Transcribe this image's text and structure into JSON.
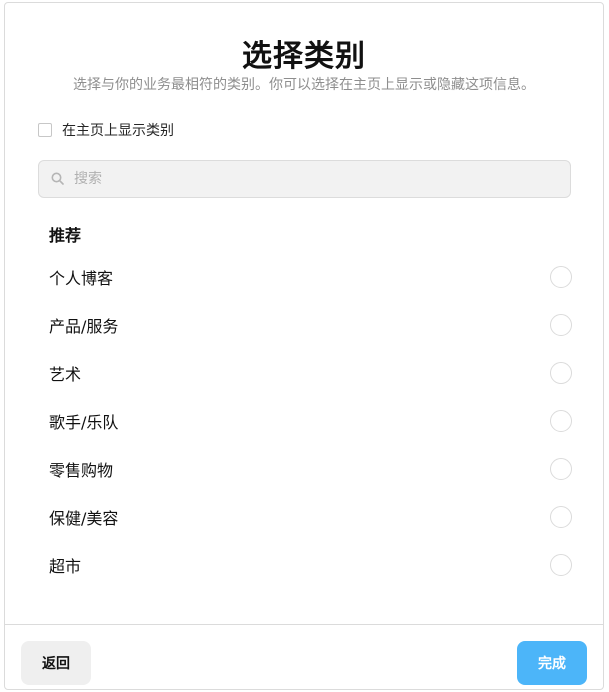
{
  "dialog": {
    "title": "选择类别",
    "subtitle": "选择与你的业务最相符的类别。你可以选择在主页上显示或隐藏这项信息。",
    "show_on_profile_label": "在主页上显示类别",
    "show_on_profile_checked": false
  },
  "search": {
    "placeholder": "搜索",
    "value": "",
    "icon": "search-icon"
  },
  "recommended": {
    "heading": "推荐",
    "items": [
      {
        "label": "个人博客",
        "selected": false
      },
      {
        "label": "产品/服务",
        "selected": false
      },
      {
        "label": "艺术",
        "selected": false
      },
      {
        "label": "歌手/乐队",
        "selected": false
      },
      {
        "label": "零售购物",
        "selected": false
      },
      {
        "label": "保健/美容",
        "selected": false
      },
      {
        "label": "超市",
        "selected": false
      }
    ]
  },
  "footer": {
    "back_label": "返回",
    "done_label": "完成"
  },
  "colors": {
    "primary_button": "#4cb5f9",
    "secondary_button": "#efefef",
    "border": "#dbdbdb"
  }
}
